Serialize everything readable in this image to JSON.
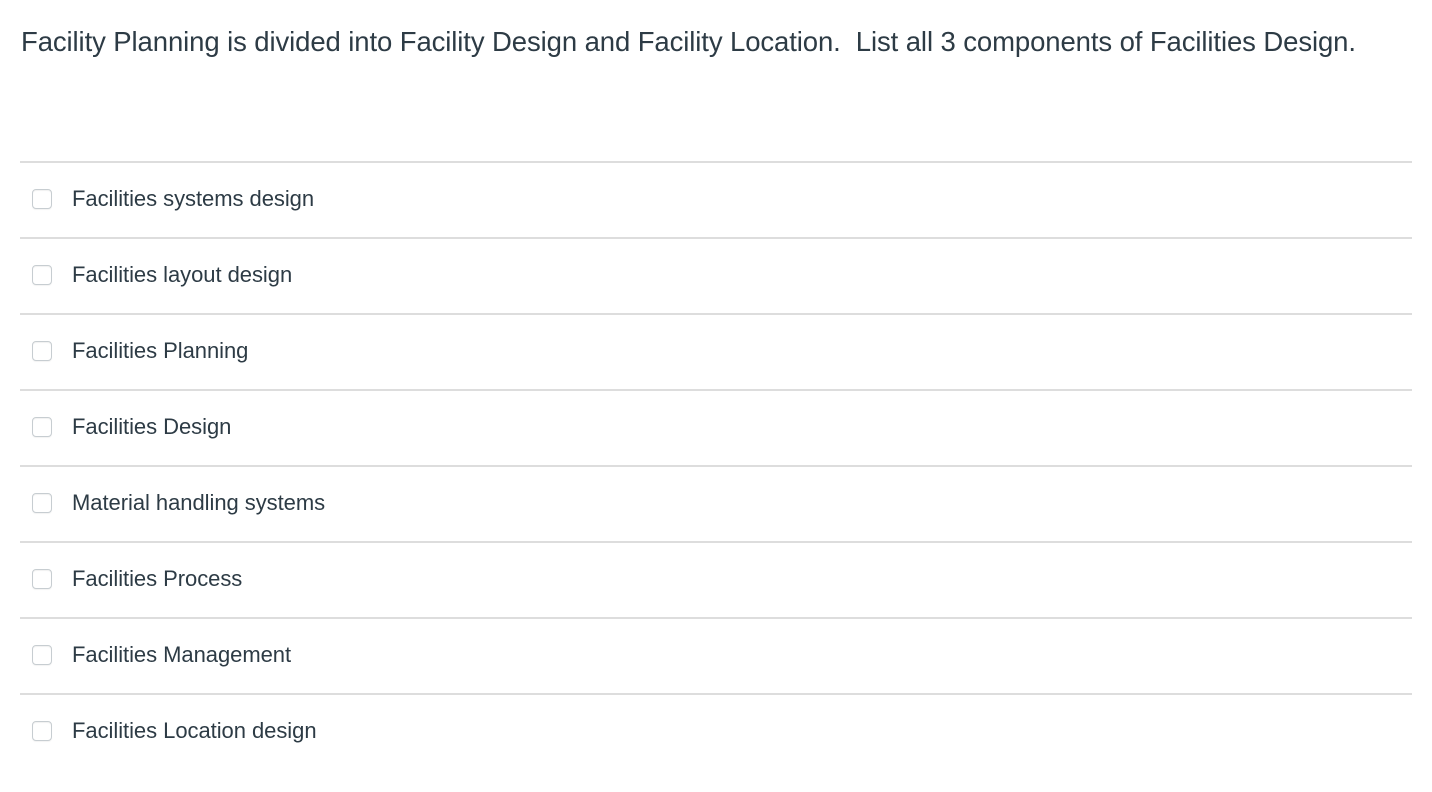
{
  "question": {
    "text": "Facility Planning is divided into Facility Design and Facility Location.  List all 3 components of Facilities Design."
  },
  "answers": {
    "input_type": "checkbox",
    "options": [
      {
        "label": "Facilities systems design",
        "checked": false
      },
      {
        "label": "Facilities layout design",
        "checked": false
      },
      {
        "label": "Facilities Planning",
        "checked": false
      },
      {
        "label": "Facilities Design",
        "checked": false
      },
      {
        "label": "Material handling systems",
        "checked": false
      },
      {
        "label": "Facilities Process",
        "checked": false
      },
      {
        "label": "Facilities Management",
        "checked": false
      },
      {
        "label": "Facilities Location design",
        "checked": false
      }
    ]
  },
  "colors": {
    "text": "#2d3b45",
    "divider": "#dddddd",
    "checkbox_border": "#c7cdd1",
    "background": "#ffffff"
  }
}
